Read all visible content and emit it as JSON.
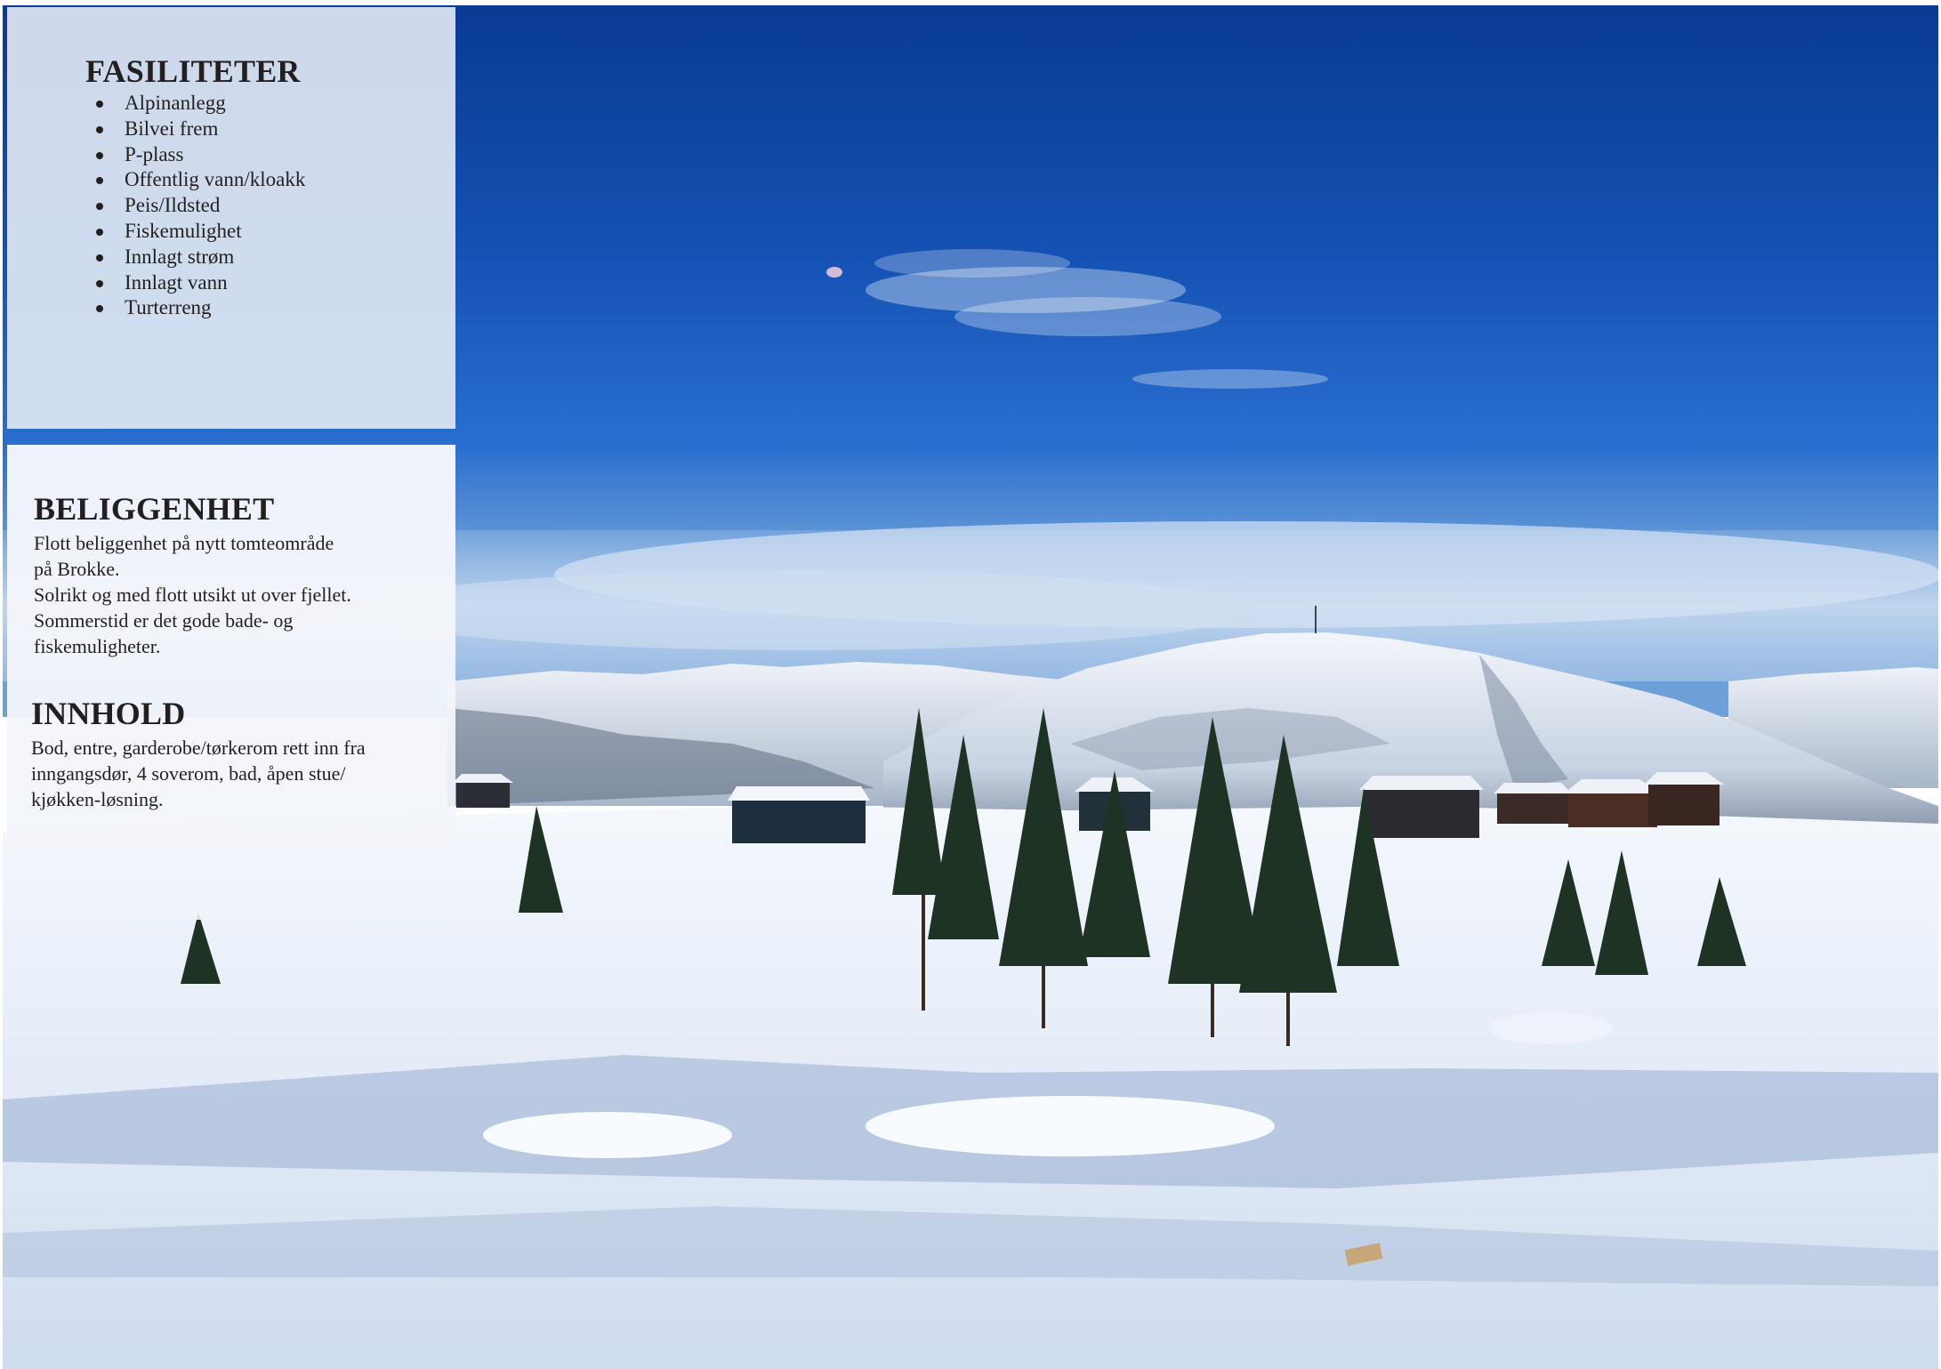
{
  "facilities": {
    "title": "FASILITETER",
    "items": [
      "Alpinanlegg",
      "Bilvei frem",
      "P-plass",
      "Offentlig vann/kloakk",
      "Peis/Ildsted",
      "Fiskemulighet",
      "Innlagt strøm",
      "Innlagt vann",
      "Turterreng"
    ]
  },
  "location": {
    "title": "BELIGGENHET",
    "lines": [
      "Flott beliggenhet på nytt tomteområde",
      "på Brokke.",
      "Solrikt og med flott utsikt ut over fjellet.",
      "Sommerstid er det gode bade- og",
      "fiskemuligheter."
    ]
  },
  "contents": {
    "title": "INNHOLD",
    "lines": [
      "Bod, entre, garderobe/tørkerom rett inn fra",
      "inngangsdør, 4 soverom, bad, åpen stue/",
      "kjøkken-løsning."
    ]
  },
  "colors": {
    "sky_top": "#0b3f9a",
    "sky_mid": "#1f62c4",
    "snow": "#e9f0fa",
    "shadow": "#8aa2c8",
    "panel_facilities": "#dee6f2",
    "panel_info": "#f4f6fb",
    "text": "#231f20"
  }
}
